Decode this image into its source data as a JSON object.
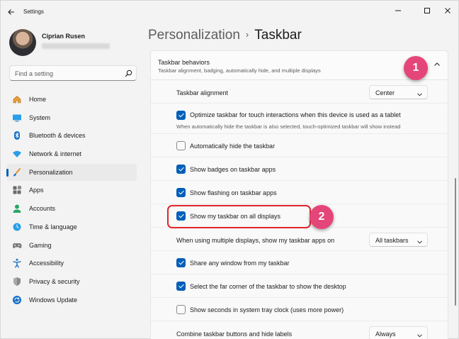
{
  "window": {
    "title": "Settings"
  },
  "profile": {
    "name": "Ciprian Rusen"
  },
  "search": {
    "placeholder": "Find a setting"
  },
  "nav": [
    {
      "label": "Home",
      "icon": "home-icon"
    },
    {
      "label": "System",
      "icon": "system-icon"
    },
    {
      "label": "Bluetooth & devices",
      "icon": "bluetooth-icon"
    },
    {
      "label": "Network & internet",
      "icon": "network-icon"
    },
    {
      "label": "Personalization",
      "icon": "brush-icon",
      "active": true
    },
    {
      "label": "Apps",
      "icon": "apps-icon"
    },
    {
      "label": "Accounts",
      "icon": "accounts-icon"
    },
    {
      "label": "Time & language",
      "icon": "time-language-icon"
    },
    {
      "label": "Gaming",
      "icon": "gaming-icon"
    },
    {
      "label": "Accessibility",
      "icon": "accessibility-icon"
    },
    {
      "label": "Privacy & security",
      "icon": "shield-icon"
    },
    {
      "label": "Windows Update",
      "icon": "update-icon"
    }
  ],
  "breadcrumb": {
    "parent": "Personalization",
    "separator": "›",
    "current": "Taskbar"
  },
  "behaviors": {
    "title": "Taskbar behaviors",
    "subtitle": "Taskbar alignment, badging, automatically hide, and multiple displays",
    "alignment": {
      "label": "Taskbar alignment",
      "value": "Center"
    },
    "optimize_touch": {
      "label": "Optimize taskbar for touch interactions when this device is used as a tablet",
      "note": "When automatically hide the taskbar is also selected, touch-optimized taskbar will show instead",
      "checked": true
    },
    "auto_hide": {
      "label": "Automatically hide the taskbar",
      "checked": false
    },
    "badges": {
      "label": "Show badges on taskbar apps",
      "checked": true
    },
    "flashing": {
      "label": "Show flashing on taskbar apps",
      "checked": true
    },
    "all_displays": {
      "label": "Show my taskbar on all displays",
      "checked": true
    },
    "multi_display_apps": {
      "label": "When using multiple displays, show my taskbar apps on",
      "value": "All taskbars"
    },
    "share_window": {
      "label": "Share any window from my taskbar",
      "checked": true
    },
    "far_corner": {
      "label": "Select the far corner of the taskbar to show the desktop",
      "checked": true
    },
    "seconds": {
      "label": "Show seconds in system tray clock (uses more power)",
      "checked": false
    },
    "combine": {
      "label": "Combine taskbar buttons and hide labels",
      "value": "Always"
    }
  },
  "callouts": {
    "one": "1",
    "two": "2"
  },
  "colors": {
    "accent": "#005fb8",
    "callout": "#e5467a",
    "highlight": "#e0262c"
  }
}
